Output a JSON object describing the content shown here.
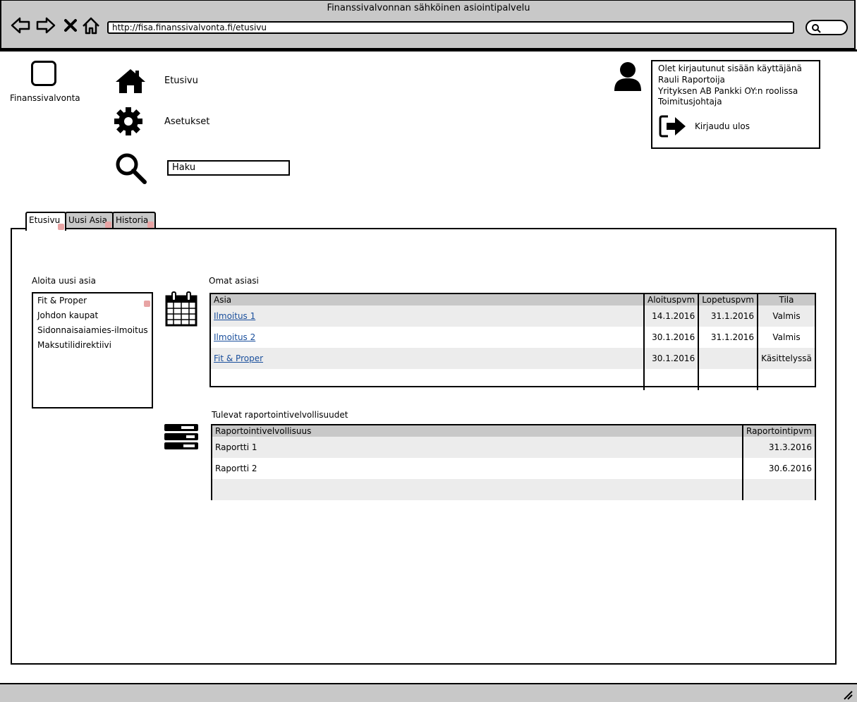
{
  "window": {
    "title": "Finanssivalvonnan sähköinen asiointipalvelu",
    "url": "http://fisa.finanssivalvonta.fi/etusivu"
  },
  "header": {
    "logo_label": "Finanssivalvonta",
    "nav": {
      "home_label": "Etusivu",
      "settings_label": "Asetukset"
    },
    "search": {
      "value": "Haku"
    },
    "user": {
      "line1": "Olet kirjautunut sisään käyttäjänä",
      "line2": "Rauli Raportoija",
      "line3": "Yrityksen AB Pankki OY:n roolissa",
      "line4": "Toimitusjohtaja",
      "logout_label": "Kirjaudu ulos"
    }
  },
  "tabs": [
    {
      "label": "Etusivu",
      "active": true
    },
    {
      "label": "Uusi Asia",
      "active": false
    },
    {
      "label": "Historia",
      "active": false
    }
  ],
  "new_case": {
    "title": "Aloita uusi asia",
    "items": [
      "Fit & Proper",
      "Johdon kaupat",
      "Sidonnaisaiamies-ilmoitus",
      "Maksutilidirektiivi"
    ]
  },
  "own_cases": {
    "title": "Omat asiasi",
    "columns": [
      "Asia",
      "Aloituspvm",
      "Lopetuspvm",
      "Tila"
    ],
    "rows": [
      [
        "Ilmoitus 1",
        "14.1.2016",
        "31.1.2016",
        "Valmis"
      ],
      [
        "Ilmoitus 2",
        "30.1.2016",
        "31.1.2016",
        "Valmis"
      ],
      [
        "Fit & Proper",
        "30.1.2016",
        "",
        "Käsittelyssä"
      ],
      [
        "",
        "",
        "",
        ""
      ]
    ]
  },
  "reporting": {
    "title": "Tulevat raportointivelvollisuudet",
    "columns": [
      "Raportointivelvollisuus",
      "Raportointipvm"
    ],
    "rows": [
      [
        "Raportti 1",
        "31.3.2016"
      ],
      [
        "Raportti 2",
        "30.6.2016"
      ],
      [
        "",
        ""
      ]
    ]
  },
  "icons": {
    "back": "arrow-left-icon",
    "forward": "arrow-right-icon",
    "stop": "close-icon",
    "home": "home-icon",
    "settings": "gear-icon",
    "search": "search-icon",
    "user": "user-icon",
    "logout": "logout-icon",
    "calendar": "calendar-icon",
    "list": "list-icon"
  }
}
